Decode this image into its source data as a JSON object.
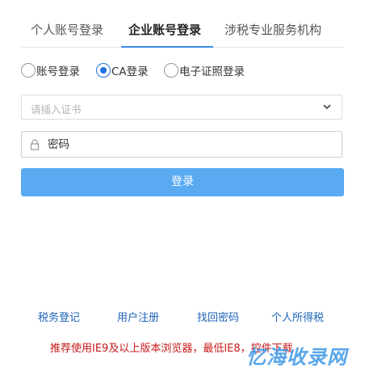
{
  "tabs": [
    {
      "label": "个人账号登录",
      "active": false
    },
    {
      "label": "企业账号登录",
      "active": true
    },
    {
      "label": "涉税专业服务机构",
      "active": false
    }
  ],
  "login_methods": [
    {
      "label": "账号登录",
      "checked": false
    },
    {
      "label": "CA登录",
      "checked": true
    },
    {
      "label": "电子证照登录",
      "checked": false
    }
  ],
  "certificate_select": {
    "placeholder": "请插入证书"
  },
  "password": {
    "placeholder": "密码",
    "value": ""
  },
  "login_button": {
    "label": "登录"
  },
  "links": [
    {
      "label": "税务登记"
    },
    {
      "label": "用户注册"
    },
    {
      "label": "找回密码"
    },
    {
      "label": "个人所得税"
    }
  ],
  "notice": "推荐使用IE9及以上版本浏览器，最低IE8，控件下载",
  "watermark": "忆海收录网",
  "colors": {
    "accent": "#1e6fd9",
    "login_button": "#5aaaf2",
    "link": "#1d63b8",
    "notice": "#c81a1a"
  }
}
